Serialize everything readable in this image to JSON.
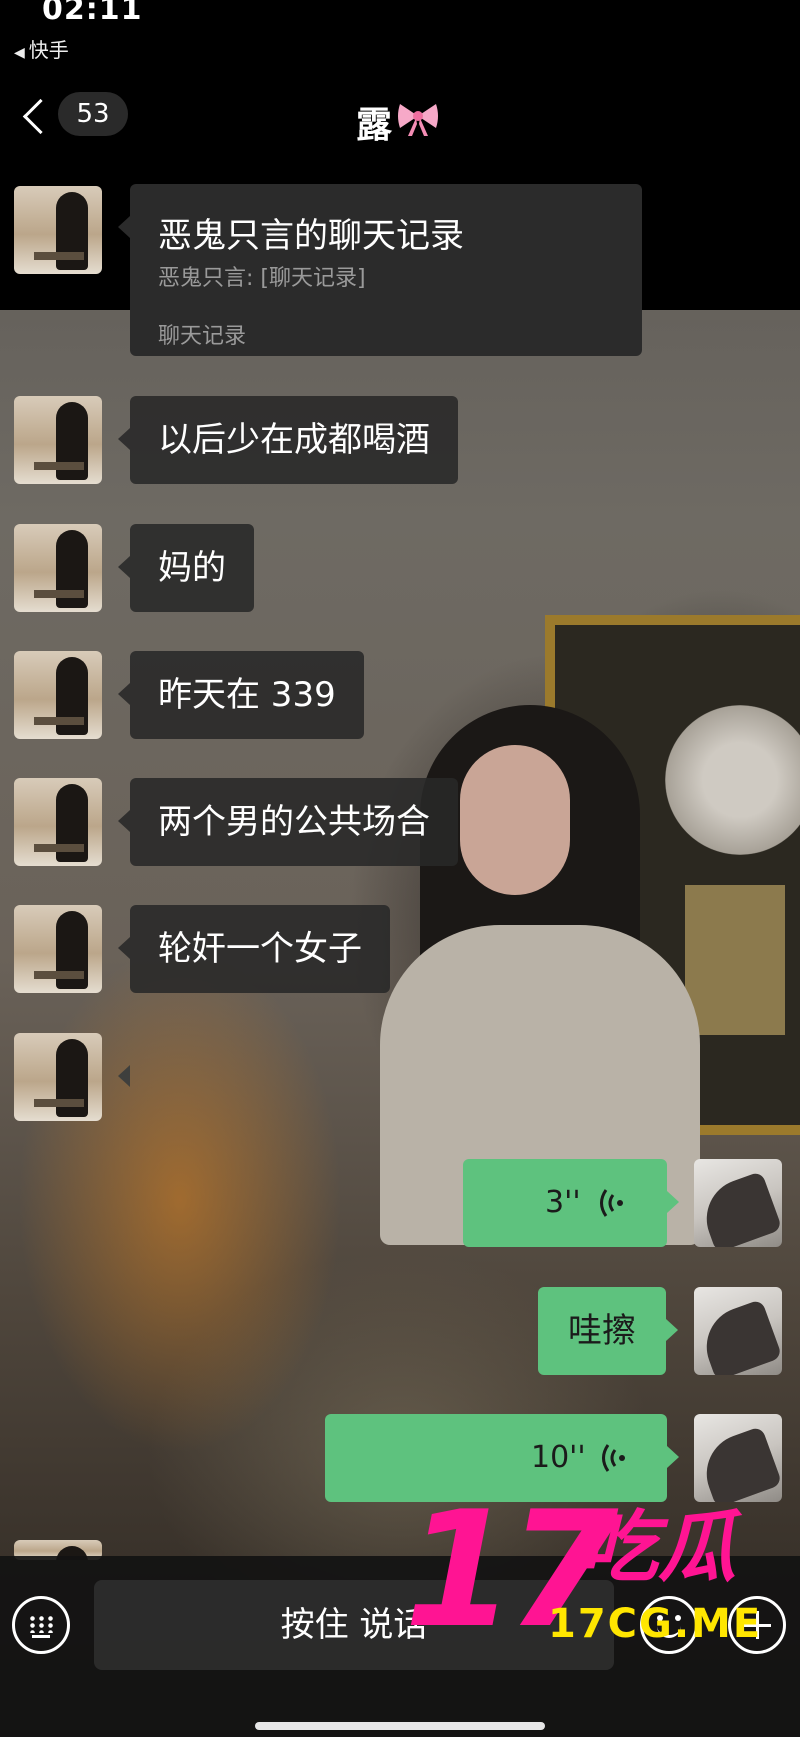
{
  "status_bar": {
    "time": "02:11",
    "back_app": "快手"
  },
  "nav": {
    "unread_count": "53",
    "contact_name": "露",
    "bow_icon": "pink-bow-emoji"
  },
  "messages": [
    {
      "type": "chat-record-card",
      "title": "恶鬼只言的聊天记录",
      "subtitle": "恶鬼只言: [聊天记录]",
      "footer": "聊天记录"
    },
    {
      "type": "text",
      "text": "以后少在成都喝酒"
    },
    {
      "type": "text",
      "text": "妈的"
    },
    {
      "type": "text",
      "text": "昨天在 339"
    },
    {
      "type": "text",
      "text": "两个男的公共场合"
    },
    {
      "type": "text",
      "text": "轮奸一个女子"
    },
    {
      "type": "blank",
      "text": ""
    },
    {
      "type": "voice",
      "duration": "3''"
    },
    {
      "type": "text-self",
      "text": "哇擦"
    },
    {
      "type": "voice",
      "duration": "10''"
    }
  ],
  "input_bar": {
    "talk_label": "按住 说话",
    "keyboard_icon": "keyboard-icon",
    "emoji_icon": "emoji-icon",
    "plus_icon": "plus-icon"
  },
  "watermark": {
    "number": "17",
    "chinese": "吃瓜",
    "url": "17CG.ME",
    "color_primary": "#ff1493",
    "color_secondary": "#ffe600"
  },
  "colors": {
    "bubble_self": "#5ec27e",
    "bubble_other": "#2b2b2b"
  }
}
